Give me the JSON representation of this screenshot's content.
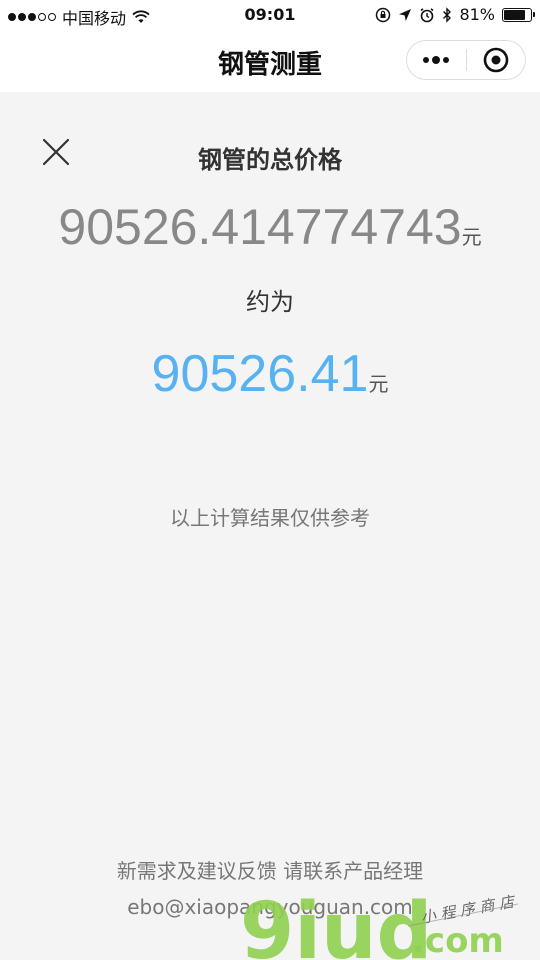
{
  "status_bar": {
    "carrier": "中国移动",
    "time": "09:01",
    "battery_percent": "81%",
    "battery_level": 0.81,
    "signal_bars_filled": 3,
    "signal_bars_total": 5,
    "icons": [
      "wifi-icon",
      "rotation-lock-icon",
      "location-icon",
      "alarm-icon",
      "bluetooth-icon",
      "battery-icon"
    ]
  },
  "nav": {
    "title": "钢管测重",
    "capsule_icons": [
      "more-dots-icon",
      "close-miniprogram-icon"
    ]
  },
  "result": {
    "title": "钢管的总价格",
    "exact_value": "90526.414774743",
    "unit": "元",
    "approx_label": "约为",
    "rounded_value": "90526.41",
    "note": "以上计算结果仅供参考",
    "accent_color": "#58b1f0"
  },
  "footer": {
    "feedback": "新需求及建议反馈 请联系产品经理",
    "email": "ebo@xiaopangyouguan.com"
  },
  "watermark": {
    "brand": "9iud",
    "domain": ".com",
    "tagline": "小程序商店",
    "color": "#8fd14f"
  }
}
